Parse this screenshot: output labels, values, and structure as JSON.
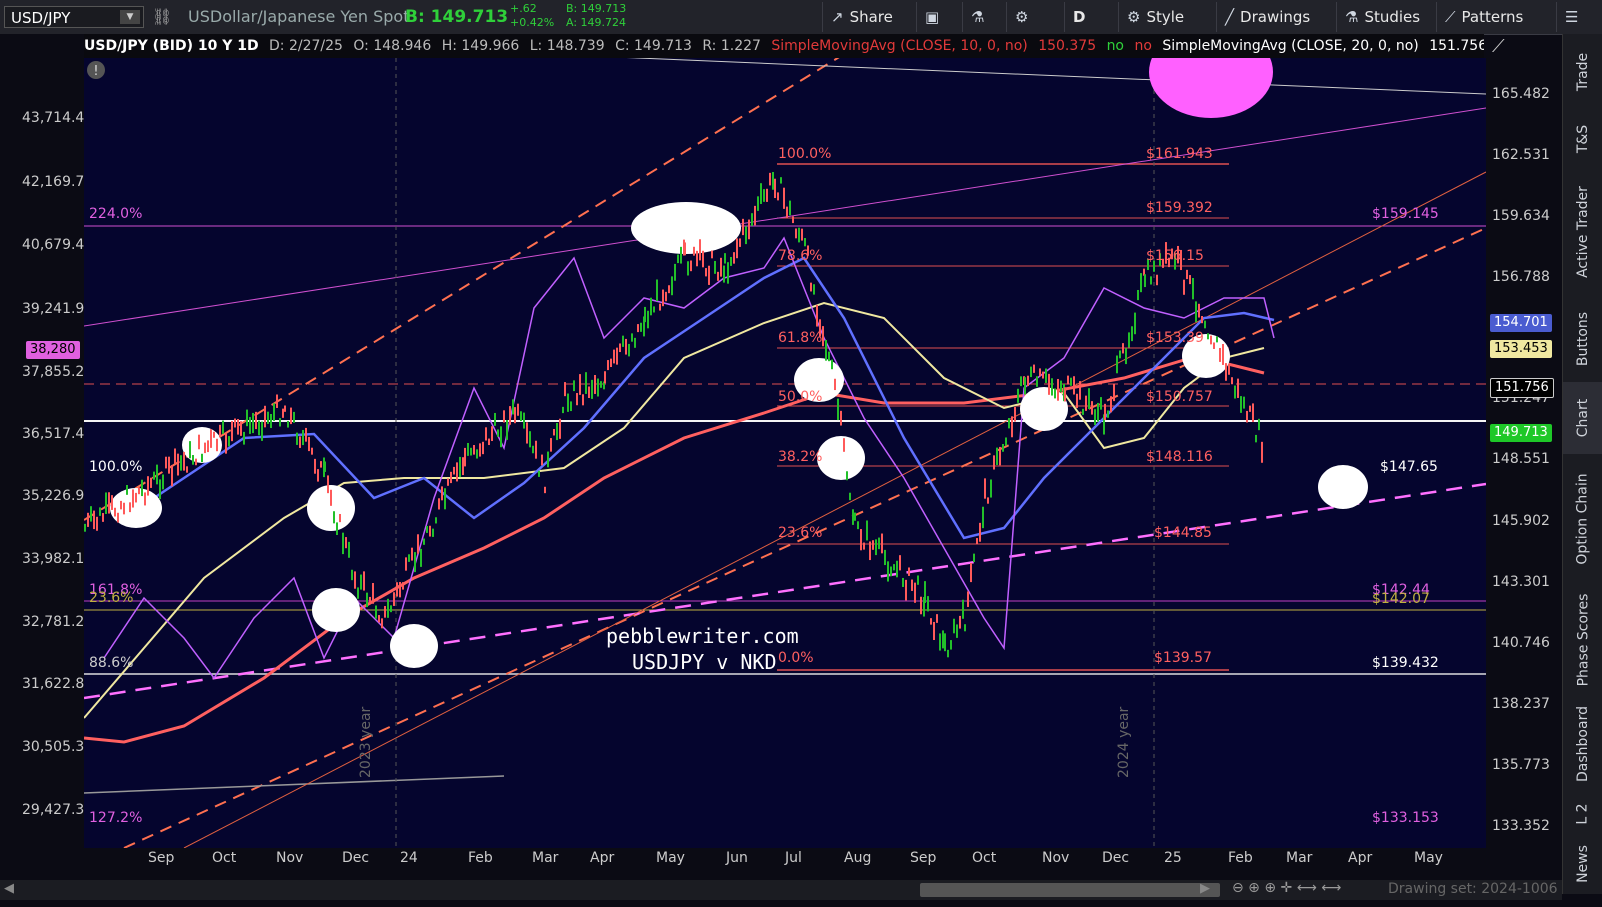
{
  "toolbar": {
    "symbol": "USD/JPY",
    "description": "USDollar/Japanese Yen Spot",
    "bid_label": "B: 149.713",
    "change": "+.62",
    "change_pct": "+0.42%",
    "bid_small": "B: 149.713",
    "ask_small": "A: 149.724",
    "buttons": [
      "Share",
      "D",
      "Style",
      "Drawings",
      "Studies",
      "Patterns"
    ]
  },
  "header": {
    "title": "USD/JPY (BID) 10 Y 1D",
    "date": "D: 2/27/25",
    "open": "O: 148.946",
    "high": "H: 149.966",
    "low": "L: 148.739",
    "close": "C: 149.713",
    "range": "R: 1.227",
    "sma10": "SimpleMovingAvg (CLOSE, 10, 0, no)",
    "sma10_val": "150.375",
    "no1": "no",
    "no2": "no",
    "sma20": "SimpleMovingAvg (CLOSE, 20, 0, no)",
    "sma20_val": "151.756",
    "no3": "no",
    "more": "..."
  },
  "left_axis": [
    "43,714.4",
    "42,169.7",
    "40,679.4",
    "39,241.9",
    "37,855.2",
    "36,517.4",
    "35,226.9",
    "33,982.1",
    "32,781.2",
    "31,622.8",
    "30,505.3",
    "29,427.3"
  ],
  "left_badge": "38,280",
  "right_axis": [
    "165.482",
    "162.531",
    "159.634",
    "156.788",
    "151.247",
    "148.551",
    "145.902",
    "143.301",
    "140.746",
    "138.237",
    "135.773",
    "133.352"
  ],
  "right_badges": {
    "sma_blue": "154.701",
    "sma_yellow": "153.453",
    "sma_white": "151.756",
    "last": "149.713"
  },
  "x_axis": [
    "Sep",
    "Oct",
    "Nov",
    "Dec",
    "24",
    "Feb",
    "Mar",
    "Apr",
    "May",
    "Jun",
    "Jul",
    "Aug",
    "Sep",
    "Oct",
    "Nov",
    "Dec",
    "25",
    "Feb",
    "Mar",
    "Apr",
    "May"
  ],
  "fib_left": [
    "100.0%",
    "78.6%",
    "61.8%",
    "50.0%",
    "38.2%",
    "23.6%",
    "0.0%"
  ],
  "fib_right": [
    "$161.943",
    "$159.392",
    "$156.15",
    "$153.39",
    "$150.757",
    "$148.116",
    "$144.85",
    "$139.57"
  ],
  "labels": {
    "pct224": "224.0%",
    "pct100": "100.0%",
    "pct1618": "161.8%",
    "pct236": "23.6%",
    "pct886": "88.6%",
    "pct1272": "127.2%",
    "lvl15914": "$159.145",
    "lvl14765": "$147.65",
    "lvl14244": "$142.44",
    "lvl14207": "$142.07",
    "lvl13943": "$139.432",
    "lvl13315": "$133.153",
    "year2023": "2023 year",
    "year2024": "2024 year",
    "watermark1": "pebblewriter.com",
    "watermark2": "USDJPY v NKD",
    "drawing_set": "Drawing set: 2024-1006"
  },
  "right_tabs": [
    "Trade",
    "T&S",
    "Active Trader",
    "Buttons",
    "Chart",
    "Option Chain",
    "Phase Scores",
    "Dashboard",
    "L 2",
    "News"
  ]
}
